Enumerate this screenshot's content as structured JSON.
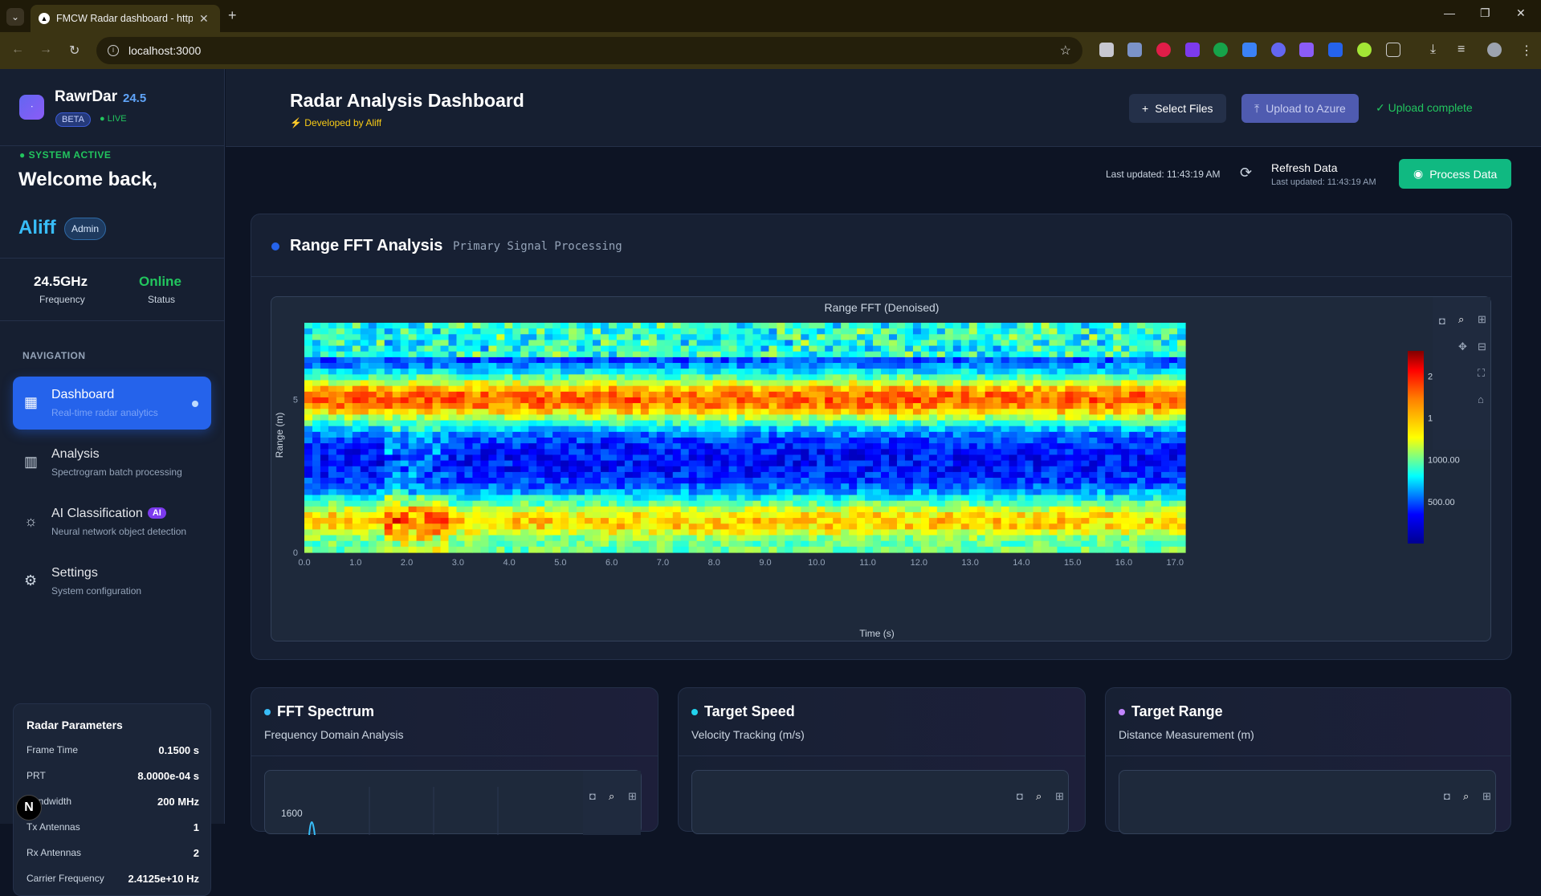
{
  "browser": {
    "tab_title": "FMCW Radar dashboard - http",
    "url": "localhost:3000"
  },
  "sidebar": {
    "brand": "RawrDar",
    "version": "24.5",
    "beta": "BETA",
    "live": "LIVE",
    "system_status": "SYSTEM ACTIVE",
    "welcome": "Welcome back,",
    "user": "Aliff",
    "role": "Admin",
    "frequency_value": "24.5GHz",
    "frequency_label": "Frequency",
    "status_value": "Online",
    "status_label": "Status",
    "nav_header": "NAVIGATION",
    "nav": [
      {
        "label": "Dashboard",
        "sub": "Real-time radar analytics"
      },
      {
        "label": "Analysis",
        "sub": "Spectrogram batch processing"
      },
      {
        "label": "AI Classification",
        "sub": "Neural network object detection",
        "badge": "AI"
      },
      {
        "label": "Settings",
        "sub": "System configuration"
      }
    ],
    "params_title": "Radar Parameters",
    "params": [
      {
        "label": "Frame Time",
        "value": "0.1500 s"
      },
      {
        "label": "PRT",
        "value": "8.0000e-04 s"
      },
      {
        "label": "Bandwidth",
        "value": "200 MHz"
      },
      {
        "label": "Tx Antennas",
        "value": "1"
      },
      {
        "label": "Rx Antennas",
        "value": "2"
      },
      {
        "label": "Carrier Frequency",
        "value": "2.4125e+10 Hz"
      }
    ]
  },
  "header": {
    "title": "Radar Analysis Dashboard",
    "subtitle": "Developed by Aliff",
    "select_files": "Select Files",
    "upload": "Upload to Azure",
    "upload_status": "✓ Upload complete",
    "last_updated": "Last updated: 11:43:19 AM",
    "refresh": "Refresh Data",
    "refresh_sub": "Last updated: 11:43:19 AM",
    "process": "Process Data"
  },
  "range_card": {
    "title": "Range FFT Analysis",
    "tag": "Primary Signal Processing"
  },
  "chart_data": {
    "type": "heatmap",
    "title": "Range FFT (Denoised)",
    "xlabel": "Time (s)",
    "ylabel": "Range (m)",
    "xticks": [
      "0.0",
      "1.0",
      "2.0",
      "3.0",
      "4.0",
      "5.0",
      "6.0",
      "7.0",
      "8.0",
      "9.0",
      "10.0",
      "11.0",
      "12.0",
      "13.0",
      "14.0",
      "15.0",
      "16.0",
      "17.0"
    ],
    "yticks": [
      "0",
      "5"
    ],
    "xlim": [
      0,
      17.2
    ],
    "ylim": [
      0,
      7.5
    ],
    "colorbar_ticks": [
      "500.00",
      "1000.00",
      "1500.00",
      "2000.00"
    ],
    "colorscale": "jet",
    "zlim": [
      0,
      2300
    ],
    "bands": [
      {
        "range_m": 5.0,
        "intensity": 1800
      },
      {
        "range_m": 1.0,
        "intensity": 1550
      },
      {
        "range_m": 3.0,
        "intensity": 300
      }
    ]
  },
  "small_cards": [
    {
      "title": "FFT Spectrum",
      "sub": "Frequency Domain Analysis",
      "color": "#38bdf8",
      "ytick": "1600"
    },
    {
      "title": "Target Speed",
      "sub": "Velocity Tracking (m/s)",
      "color": "#22d3ee",
      "ytick": ""
    },
    {
      "title": "Target Range",
      "sub": "Distance Measurement (m)",
      "color": "#c084fc",
      "ytick": ""
    }
  ]
}
